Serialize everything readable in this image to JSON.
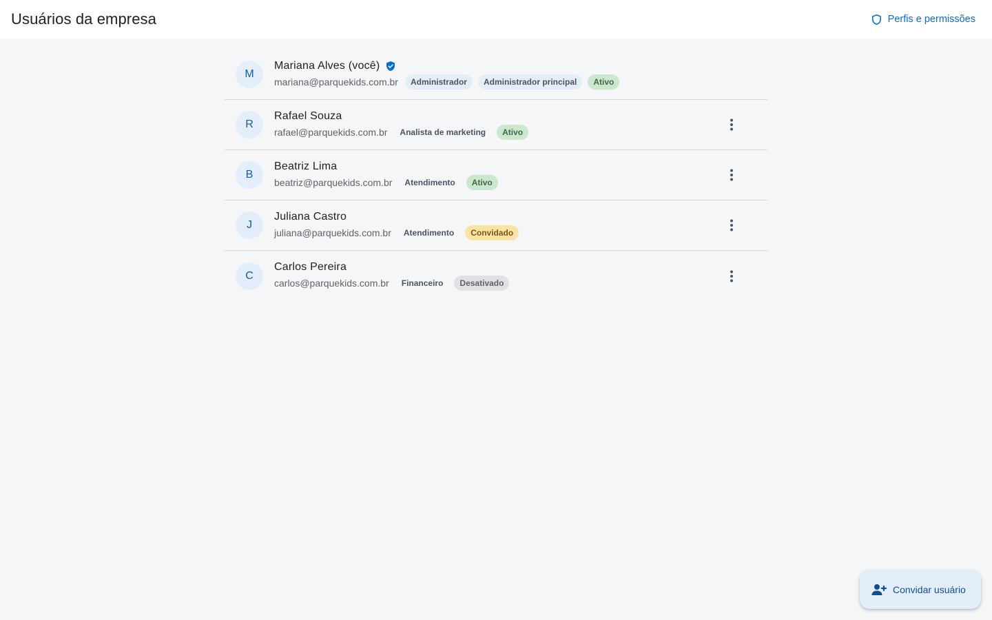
{
  "header": {
    "title": "Usuários da empresa",
    "perms_link_label": "Perfis e permissões",
    "perms_icon": "shield-icon"
  },
  "users": [
    {
      "initial": "M",
      "name": "Mariana Alves (você)",
      "verified": true,
      "email": "mariana@parquekids.com.br",
      "roles": [
        "Administrador",
        "Administrador principal"
      ],
      "status": "Ativo"
    },
    {
      "initial": "R",
      "name": "Rafael Souza",
      "email": "rafael@parquekids.com.br",
      "roles": [
        "Analista de marketing"
      ],
      "status": "Ativo"
    },
    {
      "initial": "B",
      "name": "Beatriz Lima",
      "email": "beatriz@parquekids.com.br",
      "roles": [
        "Atendimento"
      ],
      "status": "Ativo"
    },
    {
      "initial": "J",
      "name": "Juliana Castro",
      "email": "juliana@parquekids.com.br",
      "roles": [
        "Atendimento"
      ],
      "status": "Convidado"
    },
    {
      "initial": "C",
      "name": "Carlos Pereira",
      "email": "carlos@parquekids.com.br",
      "roles": [
        "Financeiro"
      ],
      "status": "Desativado"
    }
  ],
  "fab": {
    "label": "Convidar usuário",
    "icon": "person-add-icon"
  },
  "colors": {
    "accent": "#0b6bc9",
    "status_ativo": "#cde6cf",
    "status_convidado": "#fbe3a6",
    "status_desativado": "#dfe1e5"
  }
}
